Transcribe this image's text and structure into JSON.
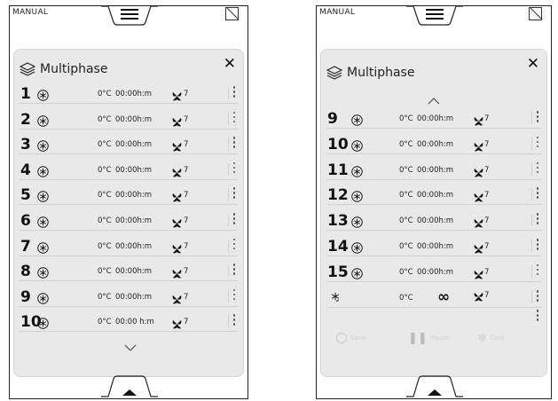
{
  "left": {
    "mode": "MANUAL",
    "title": "Multiphase",
    "rows": [
      {
        "index": "1",
        "temp": "0°C",
        "time": "00:00h:m",
        "speed": "7"
      },
      {
        "index": "2",
        "temp": "0°C",
        "time": "00:00h:m",
        "speed": "7"
      },
      {
        "index": "3",
        "temp": "0°C",
        "time": "00:00h:m",
        "speed": "7"
      },
      {
        "index": "4",
        "temp": "0°C",
        "time": "00:00h:m",
        "speed": "7"
      },
      {
        "index": "5",
        "temp": "0°C",
        "time": "00:00h:m",
        "speed": "7"
      },
      {
        "index": "6",
        "temp": "0°C",
        "time": "00:00h:m",
        "speed": "7"
      },
      {
        "index": "7",
        "temp": "0°C",
        "time": "00:00h:m",
        "speed": "7"
      },
      {
        "index": "8",
        "temp": "0°C",
        "time": "00:00h:m",
        "speed": "7"
      },
      {
        "index": "9",
        "temp": "0°C",
        "time": "00:00h:m",
        "speed": "7"
      },
      {
        "index": "10",
        "temp": "0°C",
        "time": "00:00 h:m",
        "speed": "7"
      }
    ]
  },
  "right": {
    "mode": "MANUAL",
    "title": "Multiphase",
    "rows": [
      {
        "index": "9",
        "temp": "0°C",
        "time": "00:00h:m",
        "speed": "7"
      },
      {
        "index": "10",
        "temp": "0°C",
        "time": "00:00h:m",
        "speed": "7"
      },
      {
        "index": "11",
        "temp": "0°C",
        "time": "00:00h:m",
        "speed": "7"
      },
      {
        "index": "12",
        "temp": "0°C",
        "time": "00:00h:m",
        "speed": "7"
      },
      {
        "index": "13",
        "temp": "0°C",
        "time": "00:00h:m",
        "speed": "7"
      },
      {
        "index": "14",
        "temp": "0°C",
        "time": "00:00h:m",
        "speed": "7"
      },
      {
        "index": "15",
        "temp": "0°C",
        "time": "00:00h:m",
        "speed": "7"
      }
    ],
    "hold_row": {
      "temp": "0°C",
      "duration": "∞",
      "speed": "7"
    },
    "actions": {
      "save": "Save",
      "pause": "Pause",
      "cool": "Cool"
    }
  },
  "colors": {
    "panel": "#e9e9e9",
    "disabled": "#cfcfcf"
  },
  "icons": [
    "layers-icon",
    "snowflake-icon",
    "fan-icon",
    "kebab-icon",
    "menu-icon",
    "close-icon",
    "chevron-down-icon",
    "chevron-up-icon",
    "infinity-icon",
    "arrow-up-icon"
  ]
}
